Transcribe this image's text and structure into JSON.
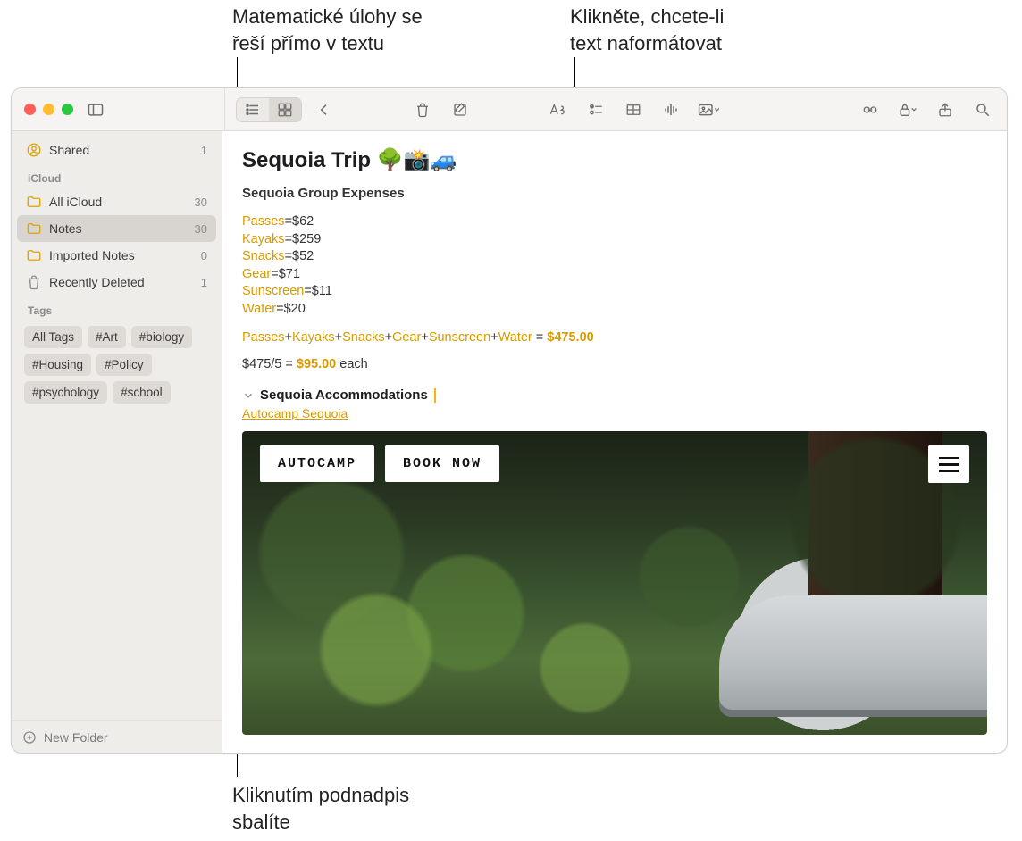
{
  "callouts": {
    "math": "Matematické úlohy se\nřeší přímo v textu",
    "format": "Klikněte, chcete-li\ntext naformátovat",
    "collapse": "Kliknutím podnadpis\nsbalíte"
  },
  "sidebar": {
    "shared": {
      "label": "Shared",
      "count": "1"
    },
    "section_icloud": "iCloud",
    "items": [
      {
        "label": "All iCloud",
        "count": "30"
      },
      {
        "label": "Notes",
        "count": "30"
      },
      {
        "label": "Imported Notes",
        "count": "0"
      },
      {
        "label": "Recently Deleted",
        "count": "1"
      }
    ],
    "section_tags": "Tags",
    "tags": [
      "All Tags",
      "#Art",
      "#biology",
      "#Housing",
      "#Policy",
      "#psychology",
      "#school"
    ],
    "footer": "New Folder"
  },
  "note": {
    "title": "Sequoia Trip 🌳📸🚙",
    "subtitle": "Sequoia Group Expenses",
    "expenses": [
      {
        "name": "Passes",
        "value": "$62"
      },
      {
        "name": "Kayaks",
        "value": "$259"
      },
      {
        "name": "Snacks",
        "value": "$52"
      },
      {
        "name": "Gear",
        "value": "$71"
      },
      {
        "name": "Sunscreen",
        "value": "$11"
      },
      {
        "name": "Water",
        "value": "$20"
      }
    ],
    "sum_vars": [
      "Passes",
      "Kayaks",
      "Snacks",
      "Gear",
      "Sunscreen",
      "Water"
    ],
    "sum_result": "$475.00",
    "per_expr": "$475/5 =",
    "per_result": "$95.00",
    "per_suffix": " each",
    "section2": "Sequoia Accommodations",
    "link": "Autocamp Sequoia",
    "image": {
      "brand": "AUTOCAMP",
      "cta": "BOOK NOW"
    }
  }
}
